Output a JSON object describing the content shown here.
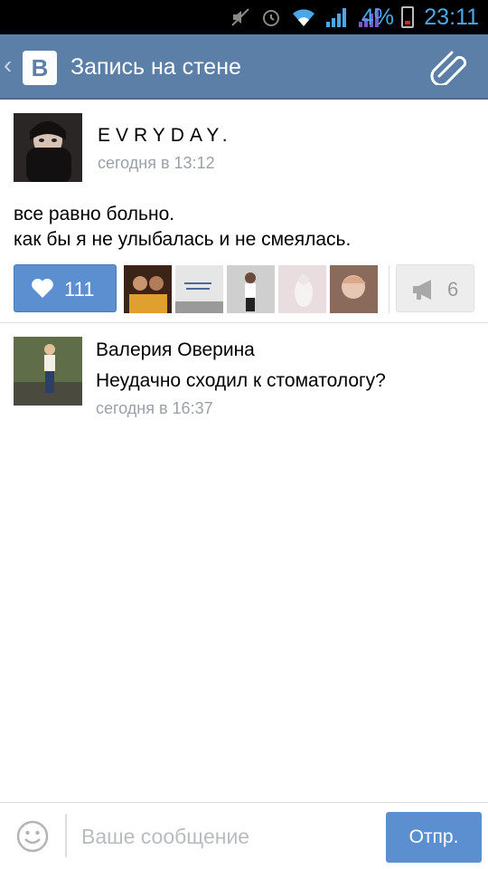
{
  "status_bar": {
    "battery_percent": "4%",
    "time": "23:11",
    "icons": [
      "muted-icon",
      "alarm-icon",
      "wifi-icon",
      "signal-icon",
      "signal-icon",
      "battery-low-icon"
    ]
  },
  "app_bar": {
    "logo_letter": "B",
    "title": "Запись на стене",
    "attach_icon": "paperclip-icon"
  },
  "post": {
    "author": "EVRYDAY.",
    "time": "сегодня в 13:12",
    "text_line1": "все равно больно.",
    "text_line2": "как бы я не улыбалась и не смеялась.",
    "likes": "111",
    "reposts": "6"
  },
  "comments": [
    {
      "author": "Валерия Оверина",
      "text": "Неудачно сходил к стоматологу?",
      "time": "сегодня в 16:37"
    }
  ],
  "composer": {
    "placeholder": "Ваше сообщение",
    "send_label": "Отпр."
  },
  "colors": {
    "accent": "#5b7fa6",
    "button": "#5b8fcf",
    "muted_text": "#9aa1a8"
  }
}
